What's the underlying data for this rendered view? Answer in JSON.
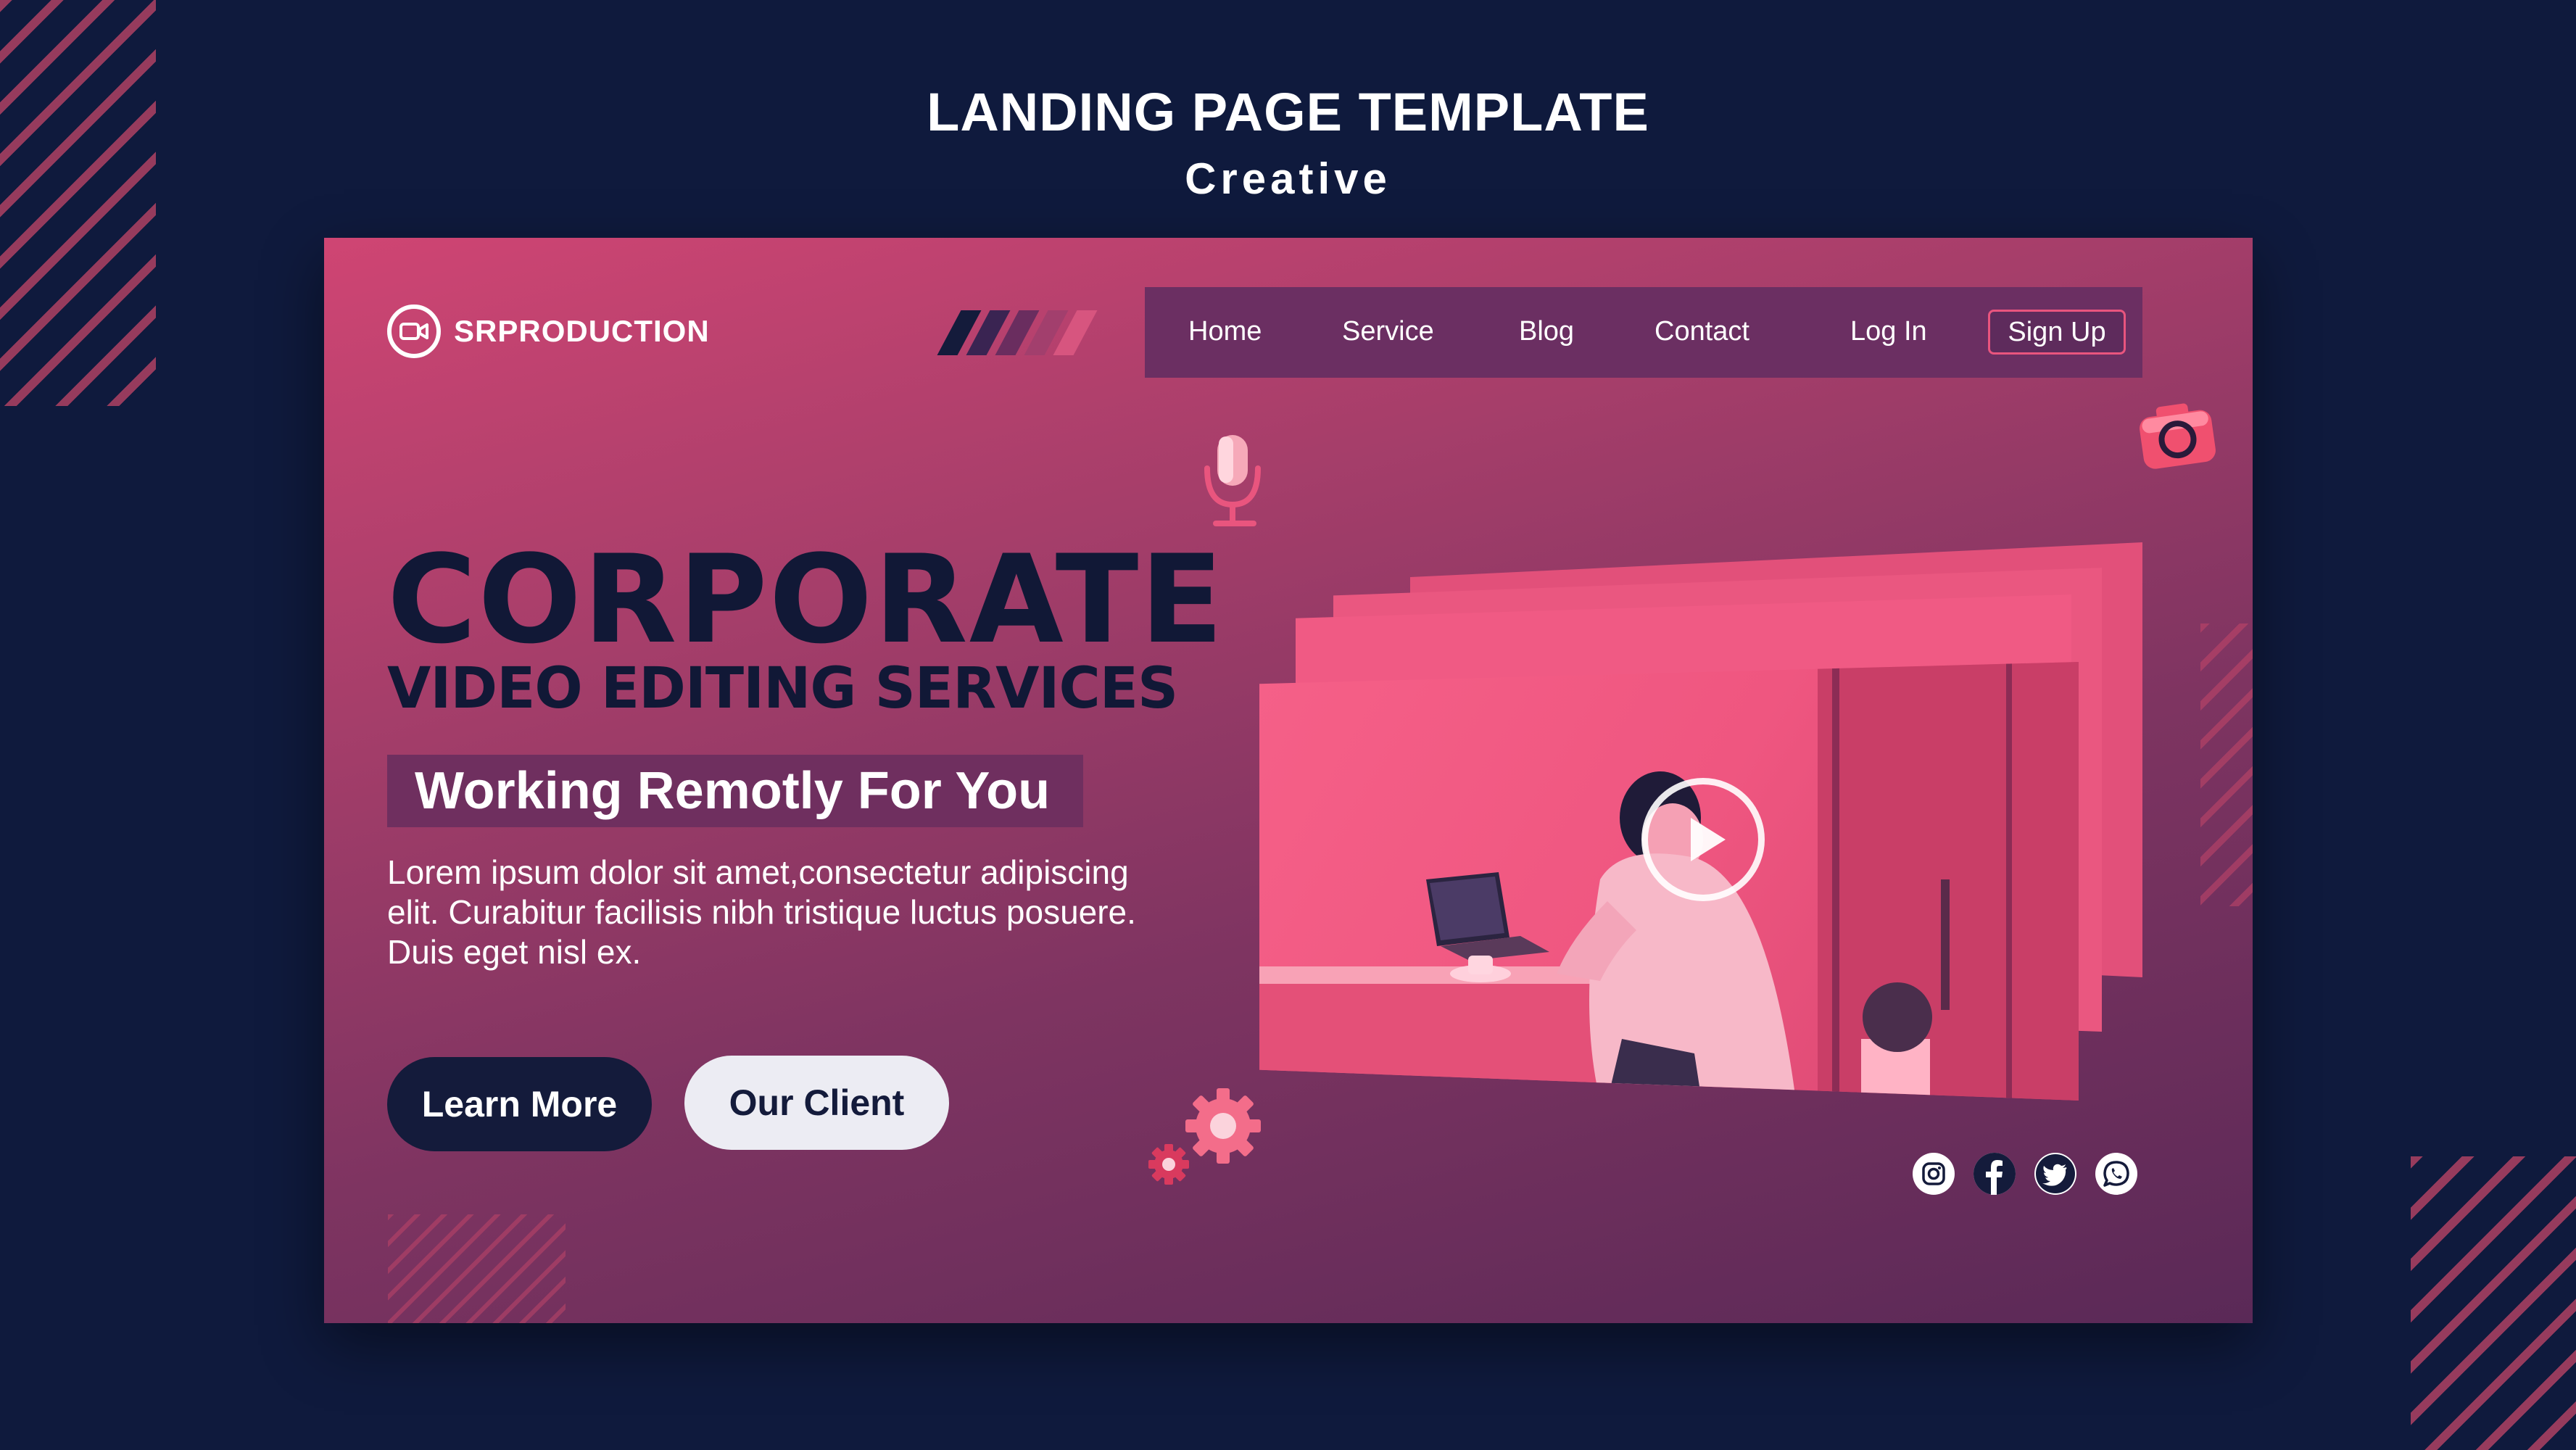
{
  "heading": {
    "title": "LANDING PAGE TEMPLATE",
    "subtitle": "Creative"
  },
  "brand": {
    "name": "SRPRODUCTION"
  },
  "nav": {
    "items": [
      "Home",
      "Service",
      "Blog",
      "Contact",
      "Log In"
    ],
    "signup": "Sign Up"
  },
  "hero": {
    "title": "CORPORATE",
    "subtitle": "VIDEO EDITING SERVICES",
    "tagline": "Working Remotly For You",
    "body": "Lorem ipsum dolor sit amet,consectetur adipiscing elit. Curabitur facilisis nibh tristique luctus posuere. Duis eget nisl ex.",
    "buttons": {
      "learn_more": "Learn More",
      "our_client": "Our Client"
    }
  },
  "icons": [
    "video-camera-icon",
    "microphone-icon",
    "camera-icon",
    "gears-icon",
    "play-icon",
    "instagram-icon",
    "facebook-icon",
    "twitter-icon",
    "whatsapp-icon"
  ],
  "colors": {
    "background": "#0f1a3d",
    "accent": "#e9557e",
    "dark": "#141b3b",
    "card_top": "#cf4573",
    "card_bottom": "#5a2957"
  }
}
